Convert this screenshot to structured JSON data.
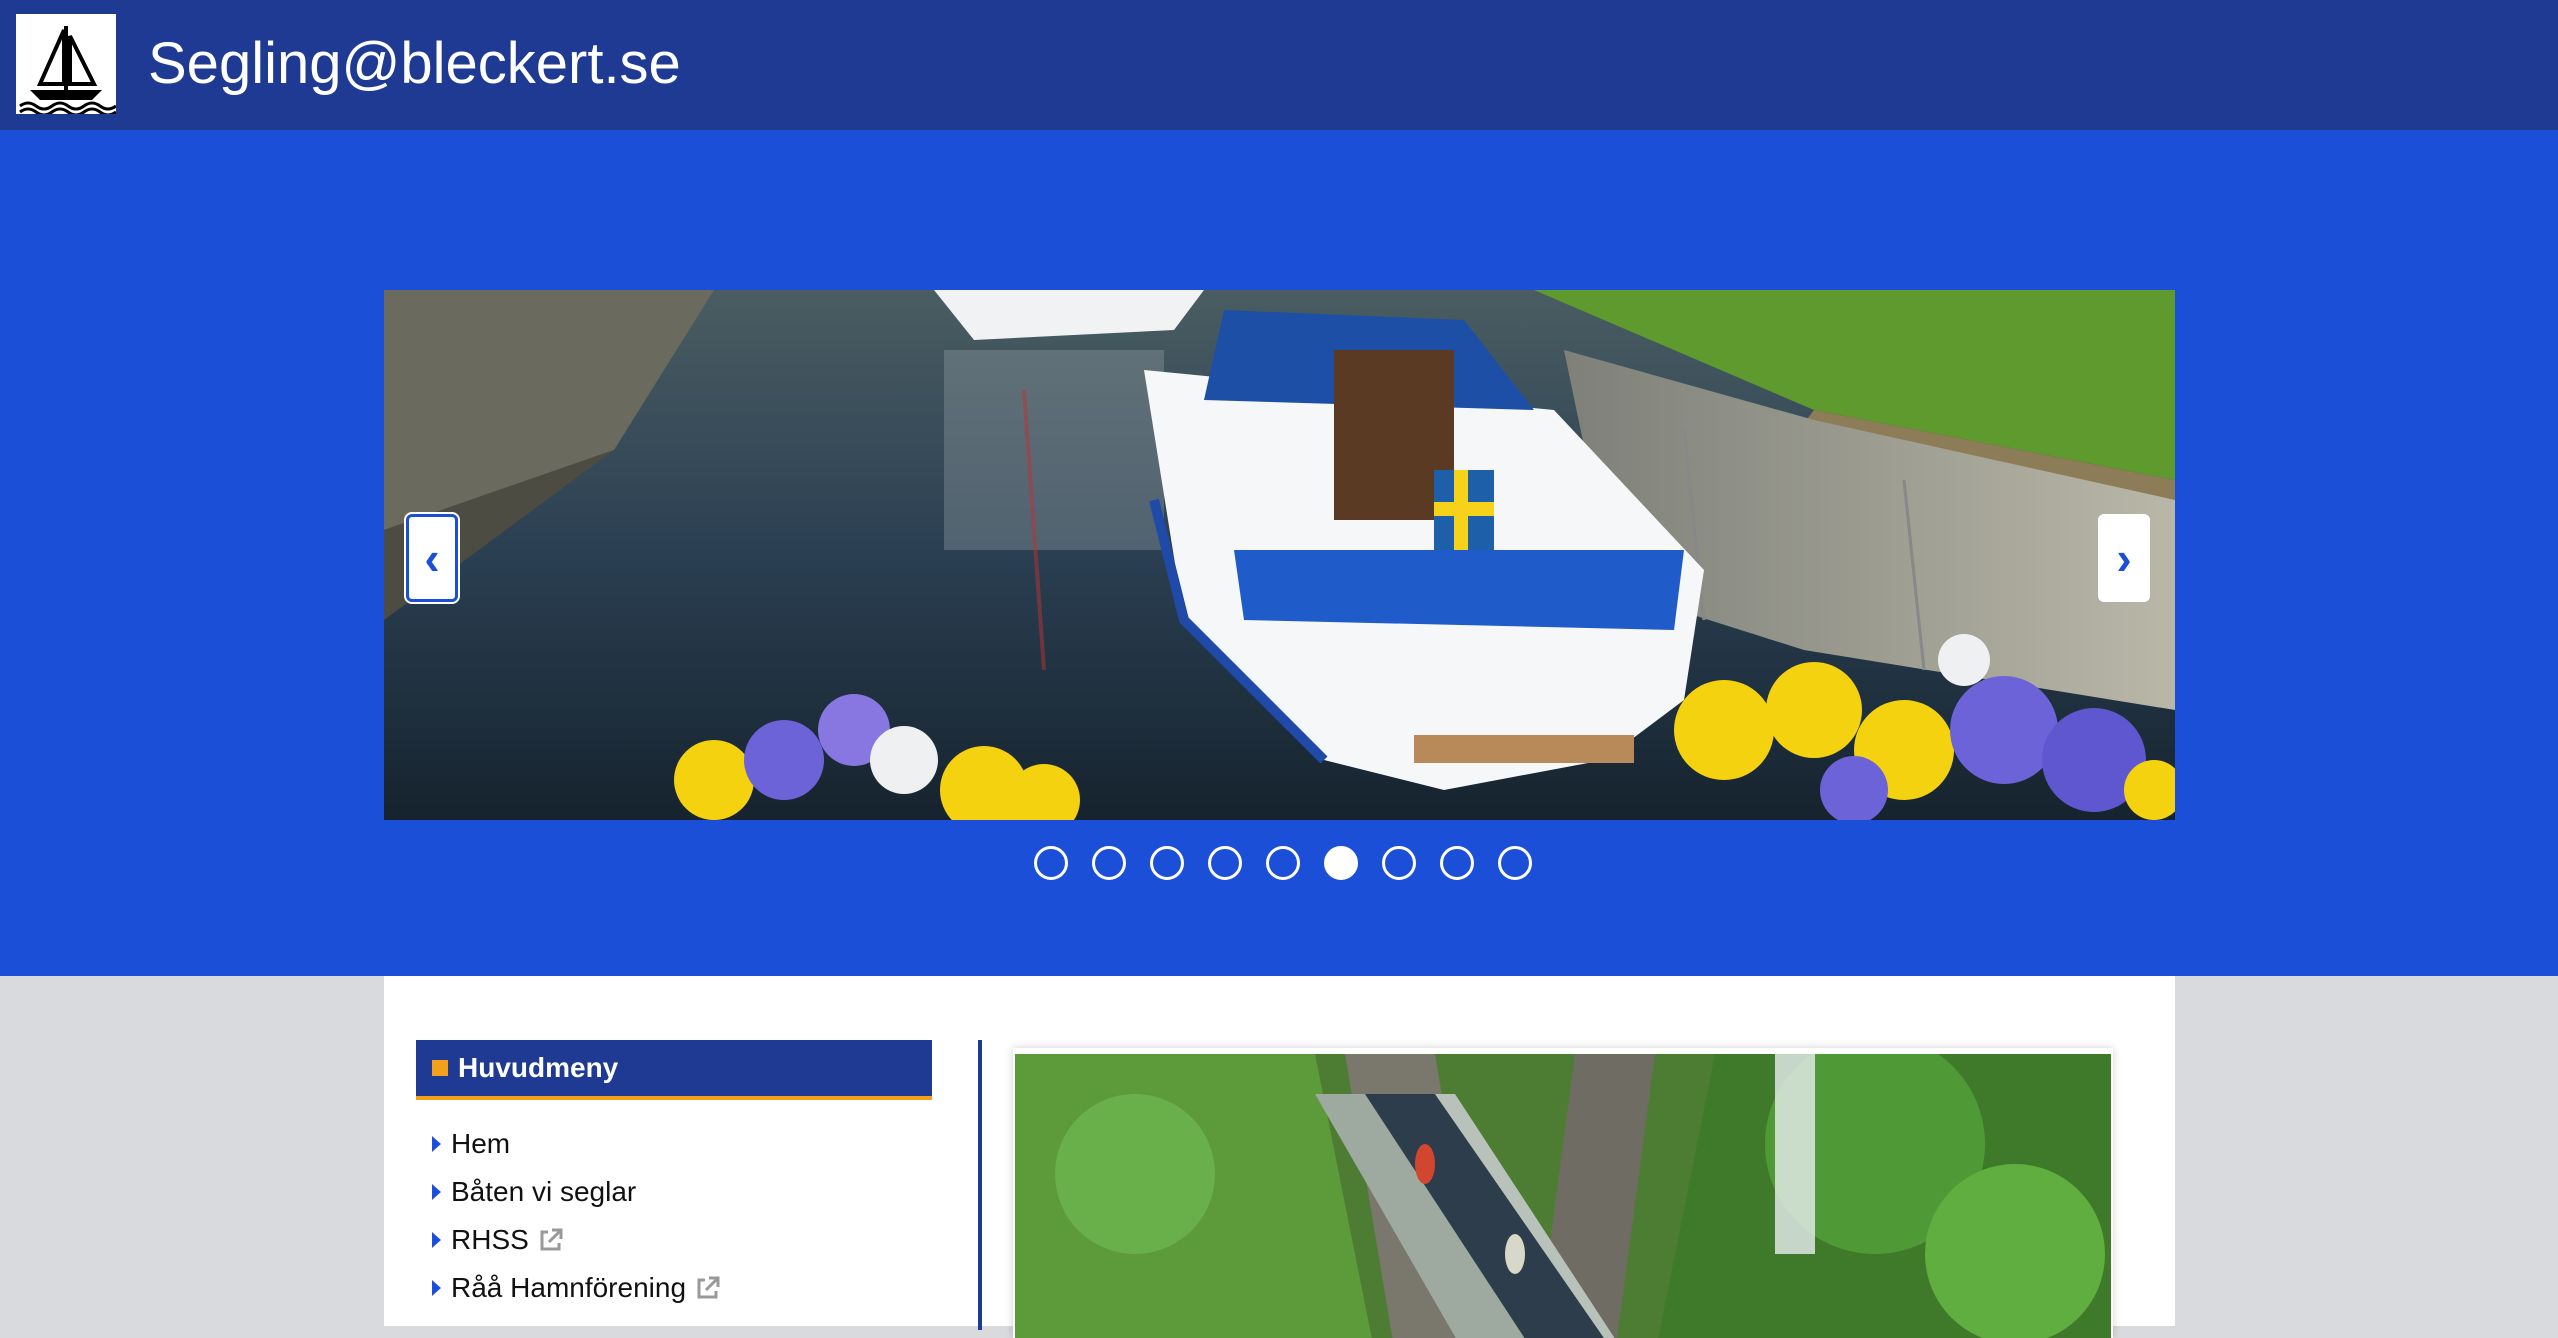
{
  "header": {
    "site_title": "Segling@bleckert.se",
    "logo_icon": "sailboat-logo-icon"
  },
  "carousel": {
    "prev_label": "‹",
    "next_label": "›",
    "slide_count": 9,
    "active_index": 6,
    "image": "sailboat-in-canal-lock-with-pansies"
  },
  "sidebar": {
    "title": "Huvudmeny",
    "items": [
      {
        "label": "Hem",
        "external": false
      },
      {
        "label": "Båten vi seglar",
        "external": false
      },
      {
        "label": "RHSS",
        "external": true
      },
      {
        "label": "Råå Hamnförening",
        "external": true
      }
    ]
  },
  "main": {
    "image": "aqueduct-canal-with-kayaks"
  },
  "colors": {
    "header_bg": "#1f3a93",
    "hero_bg": "#1c4fd8",
    "accent": "#f5a01a",
    "page_bg": "#d8dade"
  }
}
